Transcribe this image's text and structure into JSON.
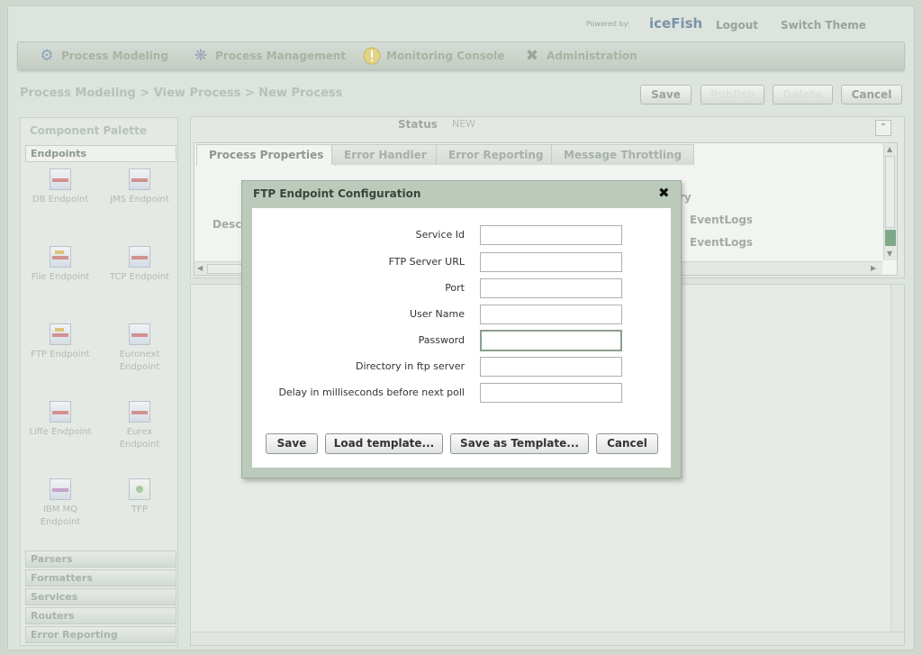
{
  "header": {
    "powered_by": "Powered by:",
    "brand": "iceFish",
    "logout": "Logout",
    "switch_theme": "Switch Theme"
  },
  "nav": [
    {
      "label": "Process Modeling",
      "icon": "gear-icon"
    },
    {
      "label": "Process Management",
      "icon": "cogs-icon"
    },
    {
      "label": "Monitoring Console",
      "icon": "warning-icon"
    },
    {
      "label": "Administration",
      "icon": "tools-icon"
    }
  ],
  "breadcrumb": "Process Modeling > View Process > New Process",
  "actions": {
    "save": "Save",
    "publish": "Publish",
    "delete": "Delete",
    "cancel": "Cancel"
  },
  "palette": {
    "title": "Component Palette",
    "open_section": "Endpoints",
    "items": [
      {
        "label": "DB Endpoint"
      },
      {
        "label": "JMS Endpoint"
      },
      {
        "label": "File Endpoint"
      },
      {
        "label": "TCP Endpoint"
      },
      {
        "label": "FTP Endpoint"
      },
      {
        "label": "Euronext Endpoint"
      },
      {
        "label": "Liffe Endpoint"
      },
      {
        "label": "Eurex Endpoint"
      },
      {
        "label": "IBM MQ Endpoint"
      },
      {
        "label": "TFP"
      }
    ],
    "sections": [
      "Parsers",
      "Formatters",
      "Services",
      "Routers",
      "Error Reporting"
    ]
  },
  "status": {
    "label": "Status",
    "value": "NEW"
  },
  "tabs": [
    "Process Properties",
    "Error Handler",
    "Error Reporting",
    "Message Throttling"
  ],
  "behind_text": {
    "ry": "ry",
    "desc": "Desc",
    "eventlogs1": "EventLogs",
    "eventlogs2": "EventLogs"
  },
  "modal": {
    "title": "FTP Endpoint Configuration",
    "fields": [
      {
        "label": "Service Id",
        "value": ""
      },
      {
        "label": "FTP Server URL",
        "value": ""
      },
      {
        "label": "Port",
        "value": ""
      },
      {
        "label": "User Name",
        "value": ""
      },
      {
        "label": "Password",
        "value": ""
      },
      {
        "label": "Directory in ftp server",
        "value": ""
      },
      {
        "label": "Delay in milliseconds before next poll",
        "value": ""
      }
    ],
    "buttons": {
      "save": "Save",
      "load": "Load template...",
      "save_template": "Save as Template...",
      "cancel": "Cancel"
    }
  }
}
